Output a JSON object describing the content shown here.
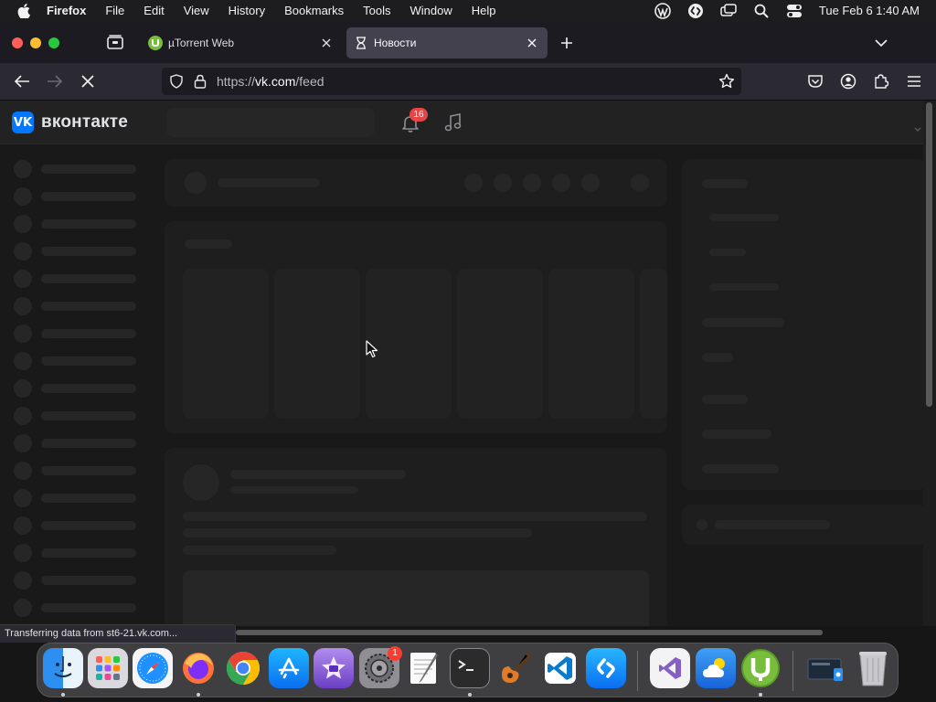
{
  "menubar": {
    "app_name": "Firefox",
    "menus": [
      "File",
      "Edit",
      "View",
      "History",
      "Bookmarks",
      "Tools",
      "Window",
      "Help"
    ],
    "clock": "Tue Feb 6  1:40 AM"
  },
  "tabs": [
    {
      "label": "µTorrent Web",
      "favicon": "utorrent-icon",
      "active": false
    },
    {
      "label": "Новости",
      "favicon": "hourglass-loading-icon",
      "active": true
    }
  ],
  "navbar": {
    "url_prefix": "https://",
    "url_host": "vk.com",
    "url_path": "/feed"
  },
  "vk": {
    "logo_letters": "VK",
    "wordmark": "вконтакте",
    "notification_count": "16",
    "accent": "#0077ff"
  },
  "status_bar": "Transferring data from st6-21.vk.com...",
  "dock": {
    "apps": [
      {
        "name": "Finder",
        "icon": "finder-icon",
        "running": true
      },
      {
        "name": "Launchpad",
        "icon": "launchpad-icon",
        "running": false
      },
      {
        "name": "Safari",
        "icon": "safari-icon",
        "running": false
      },
      {
        "name": "Firefox",
        "icon": "firefox-icon",
        "running": true
      },
      {
        "name": "Chrome",
        "icon": "chrome-icon",
        "running": false
      },
      {
        "name": "App Store",
        "icon": "app-store-icon",
        "running": false
      },
      {
        "name": "iMovie",
        "icon": "imovie-icon",
        "running": false
      },
      {
        "name": "System Settings",
        "icon": "system-settings-icon",
        "running": false,
        "badge": "1"
      },
      {
        "name": "TextEdit",
        "icon": "textedit-icon",
        "running": false
      },
      {
        "name": "Terminal",
        "icon": "terminal-icon",
        "running": true
      },
      {
        "name": "GarageBand",
        "icon": "garageband-icon",
        "running": false
      },
      {
        "name": "VS Code",
        "icon": "vscode-icon",
        "running": false
      },
      {
        "name": "Shazam",
        "icon": "shazam-icon",
        "running": false
      },
      {
        "name": "Visual Studio",
        "icon": "visual-studio-icon",
        "running": false
      },
      {
        "name": "Weather",
        "icon": "weather-icon",
        "running": false
      },
      {
        "name": "µTorrent Web",
        "icon": "utorrent-icon",
        "running": true
      },
      {
        "name": "Downloads",
        "icon": "downloads-stack-icon",
        "running": false
      },
      {
        "name": "Trash",
        "icon": "trash-icon",
        "running": false
      }
    ]
  }
}
